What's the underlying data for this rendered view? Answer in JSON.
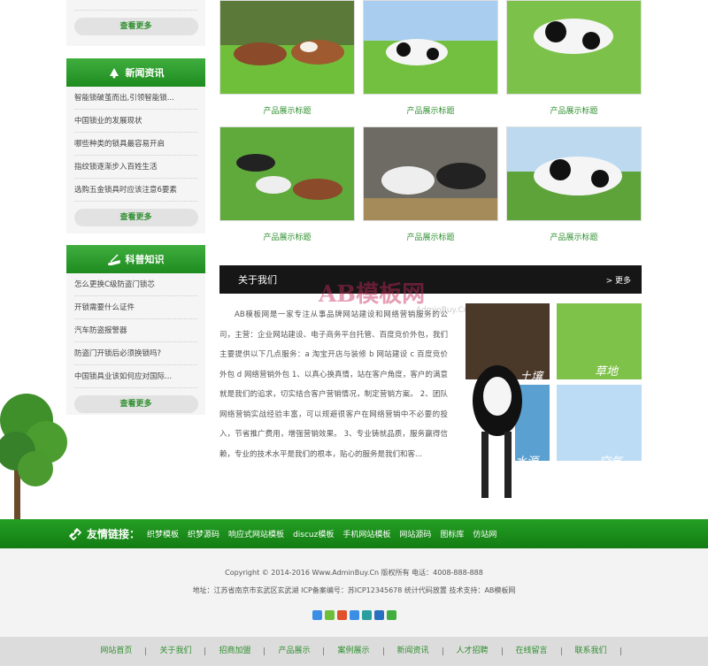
{
  "sidebar": {
    "top_more": "查看更多",
    "news": {
      "title": "新闻资讯",
      "items": [
        "智能锁破茧而出,引领智能锁...",
        "中国锁业的发展现状",
        "哪些种类的锁具最容易开启",
        "指纹锁逐渐步入百姓生活",
        "选购五金锁具时应该注意6要素"
      ],
      "more": "查看更多"
    },
    "knowledge": {
      "title": "科普知识",
      "items": [
        "怎么更换C级防盗门锁芯",
        "开锁需要什么证件",
        "汽车防盗报警器",
        "防盗门开锁后必须换锁吗?",
        "中国锁具业该如何应对国际..."
      ],
      "more": "查看更多"
    }
  },
  "products": [
    {
      "caption": "产品展示标题"
    },
    {
      "caption": "产品展示标题"
    },
    {
      "caption": "产品展示标题"
    },
    {
      "caption": "产品展示标题"
    },
    {
      "caption": "产品展示标题"
    },
    {
      "caption": "产品展示标题"
    }
  ],
  "about": {
    "title": "关于我们",
    "more": "> 更多",
    "text": "AB模板网是一家专注从事品牌网站建设和网络营销服务的公司，主营：企业网站建设、电子商务平台托管、百度竞价外包，我们主要提供以下几点服务：a 淘宝开店与装修 b 网站建设 c 百度竞价外包 d 网络营销外包 1、以真心换真情，站在客户角度，客户的满意就是我们的追求，切实结合客户营销情况，制定营销方案。 2、团队网络营销实战经验丰富，可以规避很客户在网络营销中不必要的投入，节省推广费用，增强营销效果。 3、专业铸就品质，服务赢得信赖，专业的技术水平是我们的根本，贴心的服务是我们和客...",
    "watermark": "AB模板网",
    "watermark_sub": "AdminBuy.Cn",
    "panel_labels": [
      "土壤",
      "草地",
      "水源",
      "空气"
    ]
  },
  "links": {
    "title": "友情链接：",
    "items": [
      "织梦模板",
      "织梦源码",
      "响应式网站模板",
      "discuz模板",
      "手机网站模板",
      "网站源码",
      "图标库",
      "仿站网"
    ]
  },
  "footer": {
    "line1": "Copyright © 2014-2016 Www.AdminBuy.Cn 版权所有    电话：4008-888-888",
    "line2": "地址：江苏省南京市玄武区玄武湖    ICP备案编号：苏ICP12345678    统计代码放置    技术支持：AB模板网"
  },
  "nav": [
    "网站首页",
    "关于我们",
    "招商加盟",
    "产品展示",
    "案例展示",
    "新闻资讯",
    "人才招聘",
    "在线留言",
    "联系我们"
  ],
  "colors": {
    "green": "#1f8b1f",
    "dark": "#161616"
  }
}
